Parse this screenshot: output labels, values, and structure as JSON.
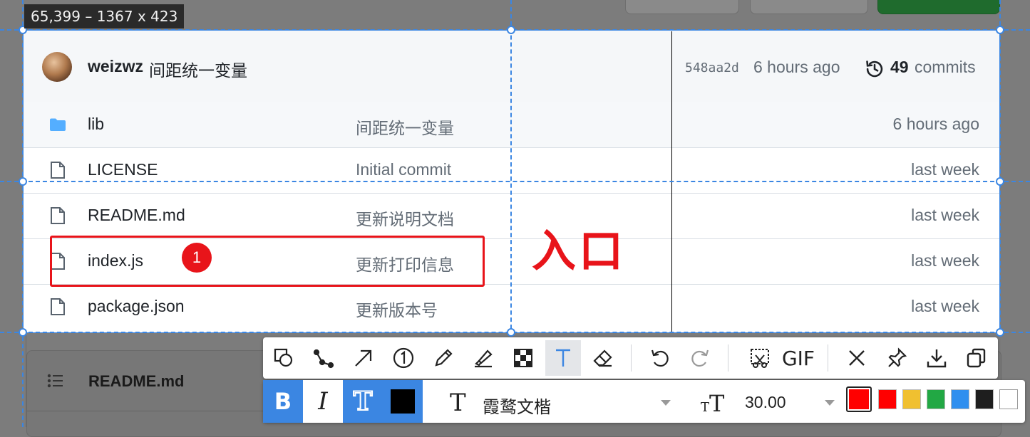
{
  "coords_label": "65,399 – 1367 x 423",
  "commit_header": {
    "user": "weizwz",
    "message": "间距统一变量",
    "sha": "548aa2d",
    "time": "6 hours ago",
    "commit_count": "49",
    "commits_label": "commits"
  },
  "files": [
    {
      "name": "lib",
      "type": "folder",
      "message": "间距统一变量",
      "time": "6 hours ago"
    },
    {
      "name": "LICENSE",
      "type": "file",
      "message": "Initial commit",
      "time": "last week"
    },
    {
      "name": "README.md",
      "type": "file",
      "message": "更新说明文档",
      "time": "last week"
    },
    {
      "name": "index.js",
      "type": "file",
      "message": "更新打印信息",
      "time": "last week"
    },
    {
      "name": "package.json",
      "type": "file",
      "message": "更新版本号",
      "time": "last week"
    }
  ],
  "annotations": {
    "step_badge": "1",
    "entry_text": "入口"
  },
  "readme_panel": {
    "title": "README.md"
  },
  "toolbar": {
    "tools": [
      "rectangle-ellipse-icon",
      "polyline-icon",
      "arrow-icon",
      "number-icon",
      "pencil-icon",
      "highlighter-icon",
      "mosaic-icon",
      "text-icon",
      "eraser-icon",
      "undo-icon",
      "redo-icon",
      "scroll-capture-icon",
      "gif-icon",
      "close-icon",
      "pin-icon",
      "download-icon",
      "copy-icon"
    ],
    "active_tool": "text-icon",
    "gif_label": "GIF"
  },
  "text_options": {
    "bold": "B",
    "italic": "I",
    "outline": "T",
    "font_icon": "T",
    "font_name": "霞鹜文楷",
    "size_value": "30.00",
    "selected_color": "#ff0000",
    "colors": [
      "#ff0000",
      "#f0c030",
      "#22a844",
      "#2f8fef",
      "#1e1e1e",
      "#ffffff"
    ]
  },
  "colors": {
    "accent": "#3b86e2",
    "annotation_red": "#e8141a"
  }
}
